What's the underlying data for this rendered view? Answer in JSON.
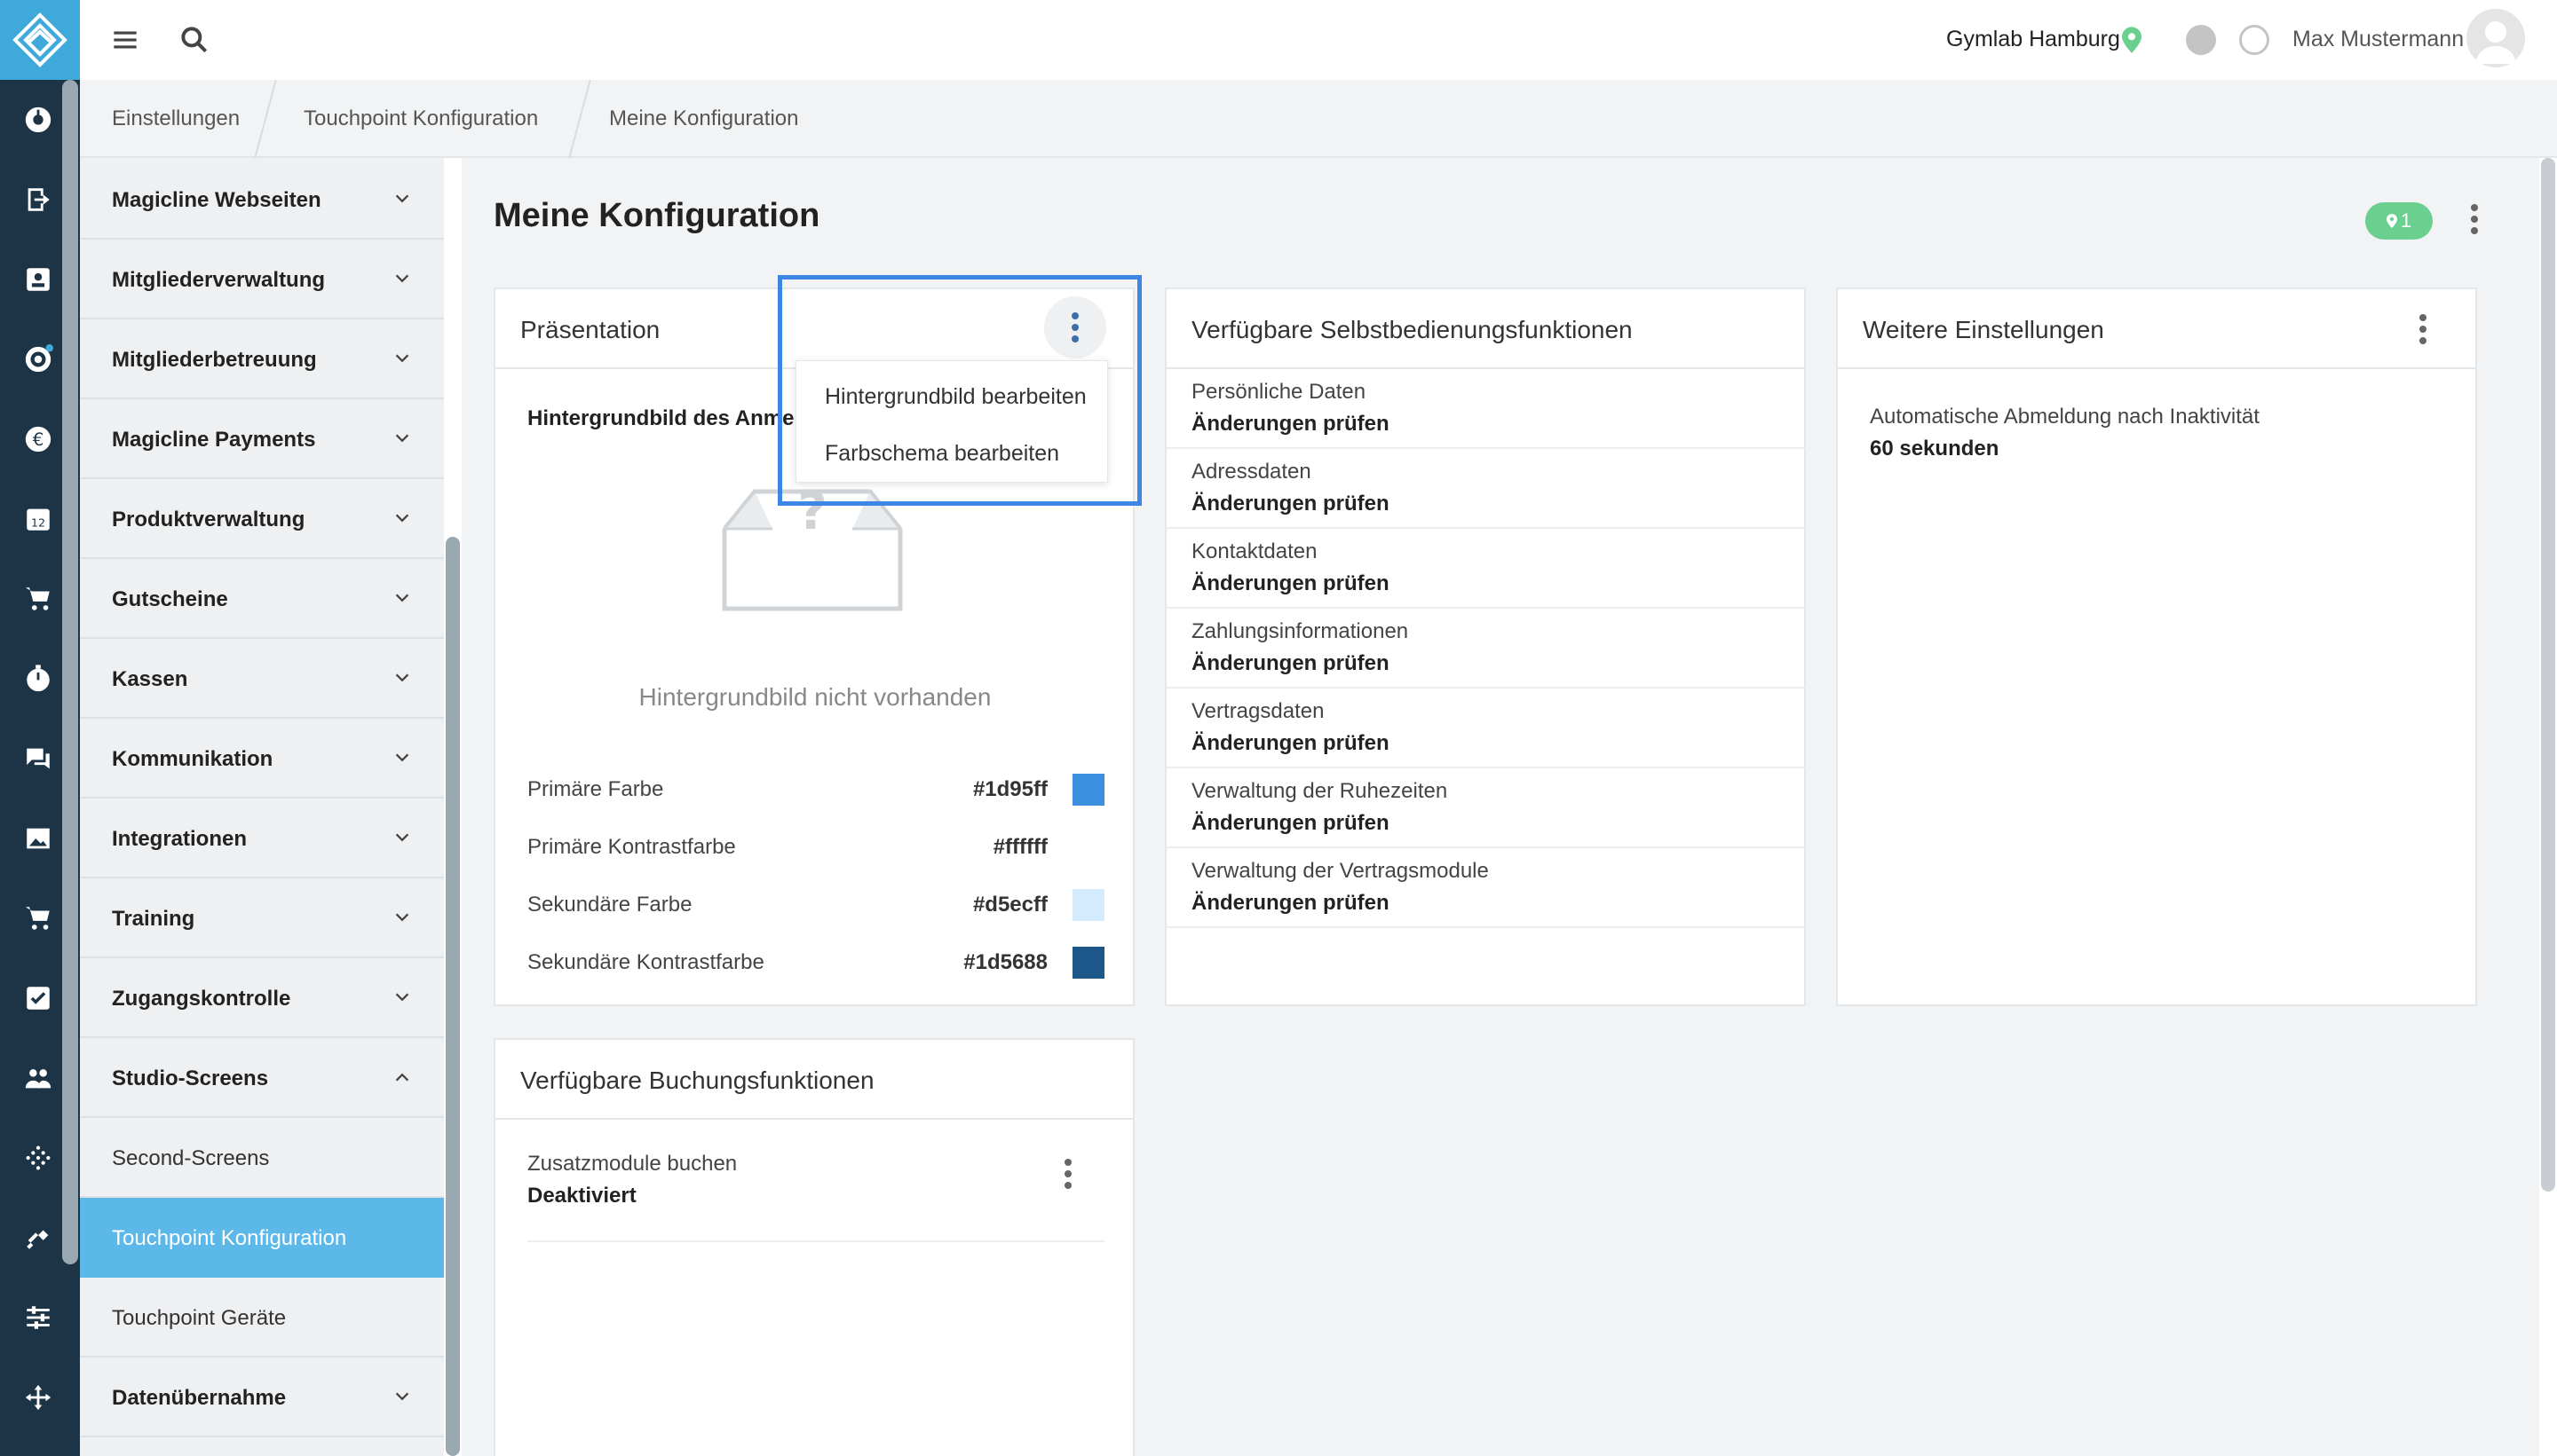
{
  "app": {
    "brand_color": "#3fa9dc",
    "rail_color": "#1c3446"
  },
  "topbar": {
    "studio": "Gymlab Hamburg",
    "user": "Max Mustermann"
  },
  "breadcrumb": [
    "Einstellungen",
    "Touchpoint Konfiguration",
    "Meine Konfiguration"
  ],
  "sidebar": {
    "items": [
      {
        "label": "Magicline Webseiten"
      },
      {
        "label": "Mitgliederverwaltung"
      },
      {
        "label": "Mitgliederbetreuung"
      },
      {
        "label": "Magicline Payments"
      },
      {
        "label": "Produktverwaltung"
      },
      {
        "label": "Gutscheine"
      },
      {
        "label": "Kassen"
      },
      {
        "label": "Kommunikation"
      },
      {
        "label": "Integrationen"
      },
      {
        "label": "Training"
      },
      {
        "label": "Zugangskontrolle"
      },
      {
        "label": "Studio-Screens",
        "expanded": true
      },
      {
        "label": "Second-Screens",
        "sub": true
      },
      {
        "label": "Touchpoint Konfiguration",
        "sub": true,
        "active": true
      },
      {
        "label": "Touchpoint Geräte",
        "sub": true
      },
      {
        "label": "Datenübernahme"
      }
    ]
  },
  "page": {
    "title": "Meine Konfiguration",
    "badge_count": "1"
  },
  "presentation": {
    "title": "Präsentation",
    "background_label": "Hintergrundbild des Anmel",
    "empty_text": "Hintergrundbild nicht vorhanden",
    "menu": [
      "Hintergrundbild bearbeiten",
      "Farbschema bearbeiten"
    ],
    "colors": [
      {
        "name": "Primäre Farbe",
        "hex": "#1d95ff",
        "swatch": "#3d8fe0"
      },
      {
        "name": "Primäre Kontrastfarbe",
        "hex": "#ffffff",
        "swatch": "#ffffff"
      },
      {
        "name": "Sekundäre Farbe",
        "hex": "#d5ecff",
        "swatch": "#d5ecff"
      },
      {
        "name": "Sekundäre Kontrastfarbe",
        "hex": "#1d5688",
        "swatch": "#1d5688"
      }
    ]
  },
  "selfservice": {
    "title": "Verfügbare Selbstbedienungsfunktionen",
    "items": [
      {
        "label": "Persönliche Daten",
        "value": "Änderungen prüfen"
      },
      {
        "label": "Adressdaten",
        "value": "Änderungen prüfen"
      },
      {
        "label": "Kontaktdaten",
        "value": "Änderungen prüfen"
      },
      {
        "label": "Zahlungsinformationen",
        "value": "Änderungen prüfen"
      },
      {
        "label": "Vertragsdaten",
        "value": "Änderungen prüfen"
      },
      {
        "label": "Verwaltung der Ruhezeiten",
        "value": "Änderungen prüfen"
      },
      {
        "label": "Verwaltung der Vertragsmodule",
        "value": "Änderungen prüfen"
      }
    ]
  },
  "further": {
    "title": "Weitere Einstellungen",
    "label": "Automatische Abmeldung nach Inaktivität",
    "value": "60 sekunden"
  },
  "booking": {
    "title": "Verfügbare Buchungsfunktionen",
    "label": "Zusatzmodule buchen",
    "value": "Deaktiviert"
  }
}
